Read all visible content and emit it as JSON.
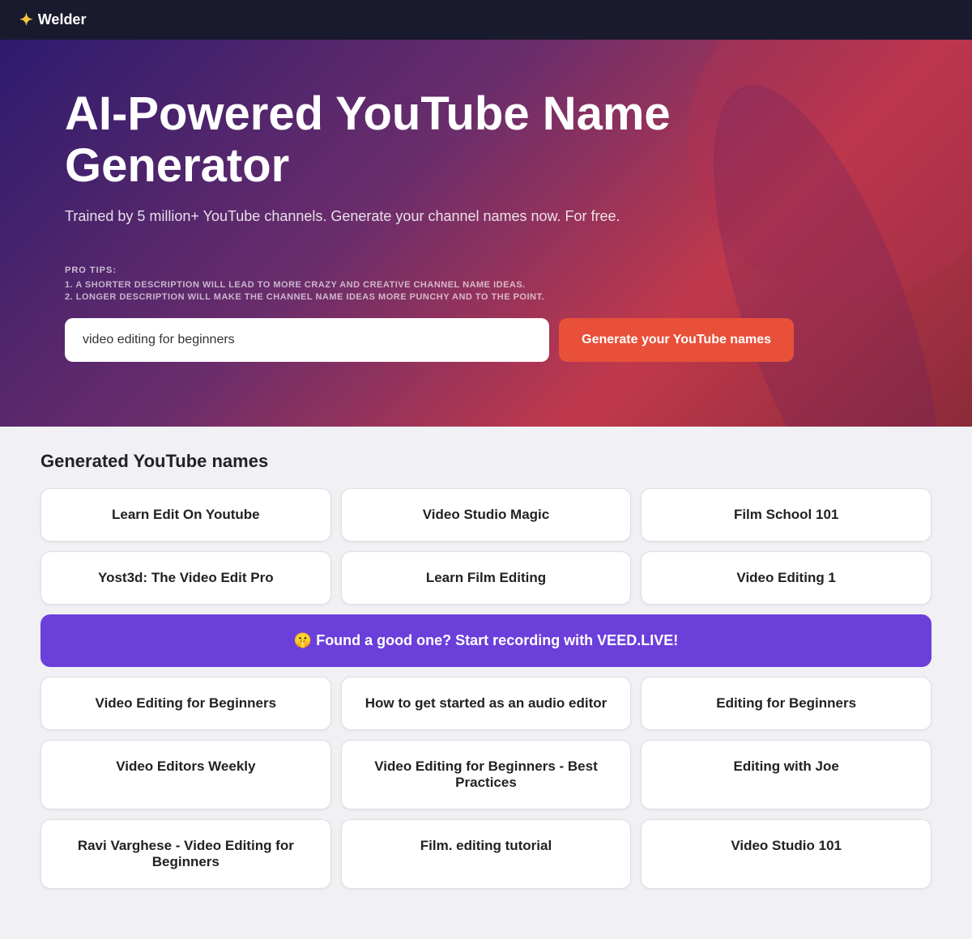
{
  "header": {
    "logo_icon": "✦",
    "logo_text": "Welder"
  },
  "hero": {
    "title": "AI-Powered YouTube Name Generator",
    "subtitle": "Trained by 5 million+ YouTube channels. Generate your channel names now. For free.",
    "pro_tips_label": "PRO TIPS:",
    "pro_tip_1": "1. A SHORTER DESCRIPTION WILL LEAD TO MORE CRAZY AND CREATIVE CHANNEL NAME IDEAS.",
    "pro_tip_2": "2. LONGER DESCRIPTION WILL MAKE THE CHANNEL NAME IDEAS MORE PUNCHY AND TO THE POINT.",
    "input_value": "video editing for beginners",
    "input_placeholder": "video editing for beginners",
    "button_label": "Generate your YouTube names"
  },
  "results": {
    "title": "Generated YouTube names",
    "promo_text": "🤫 Found a good one? Start recording with VEED.LIVE!",
    "names_row1": [
      "Learn Edit On Youtube",
      "Video Studio Magic",
      "Film School 101"
    ],
    "names_row2": [
      "Yost3d: The Video Edit Pro",
      "Learn Film Editing",
      "Video Editing 1"
    ],
    "names_row3": [
      "Video Editing for Beginners",
      "How to get started as an audio editor",
      "Editing for Beginners"
    ],
    "names_row4": [
      "Video Editors Weekly",
      "Video Editing for Beginners - Best Practices",
      "Editing with Joe"
    ],
    "names_row5": [
      "Ravi Varghese - Video Editing for Beginners",
      "Film. editing tutorial",
      "Video Studio 101"
    ]
  }
}
